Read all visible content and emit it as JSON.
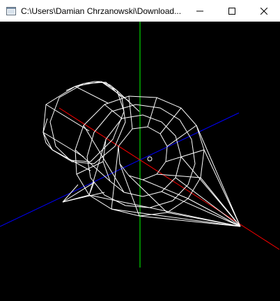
{
  "window": {
    "title": "C:\\Users\\Damian Chrzanowski\\Download...",
    "icon": "console-app-icon",
    "controls": {
      "minimize_icon": "minimize-icon",
      "maximize_icon": "maximize-icon",
      "close_icon": "close-icon"
    }
  },
  "scene": {
    "background": "#000000",
    "wire_color": "#ffffff",
    "axis_colors": {
      "x": "#ff0000",
      "y": "#00ff00",
      "z": "#0000ff"
    }
  }
}
